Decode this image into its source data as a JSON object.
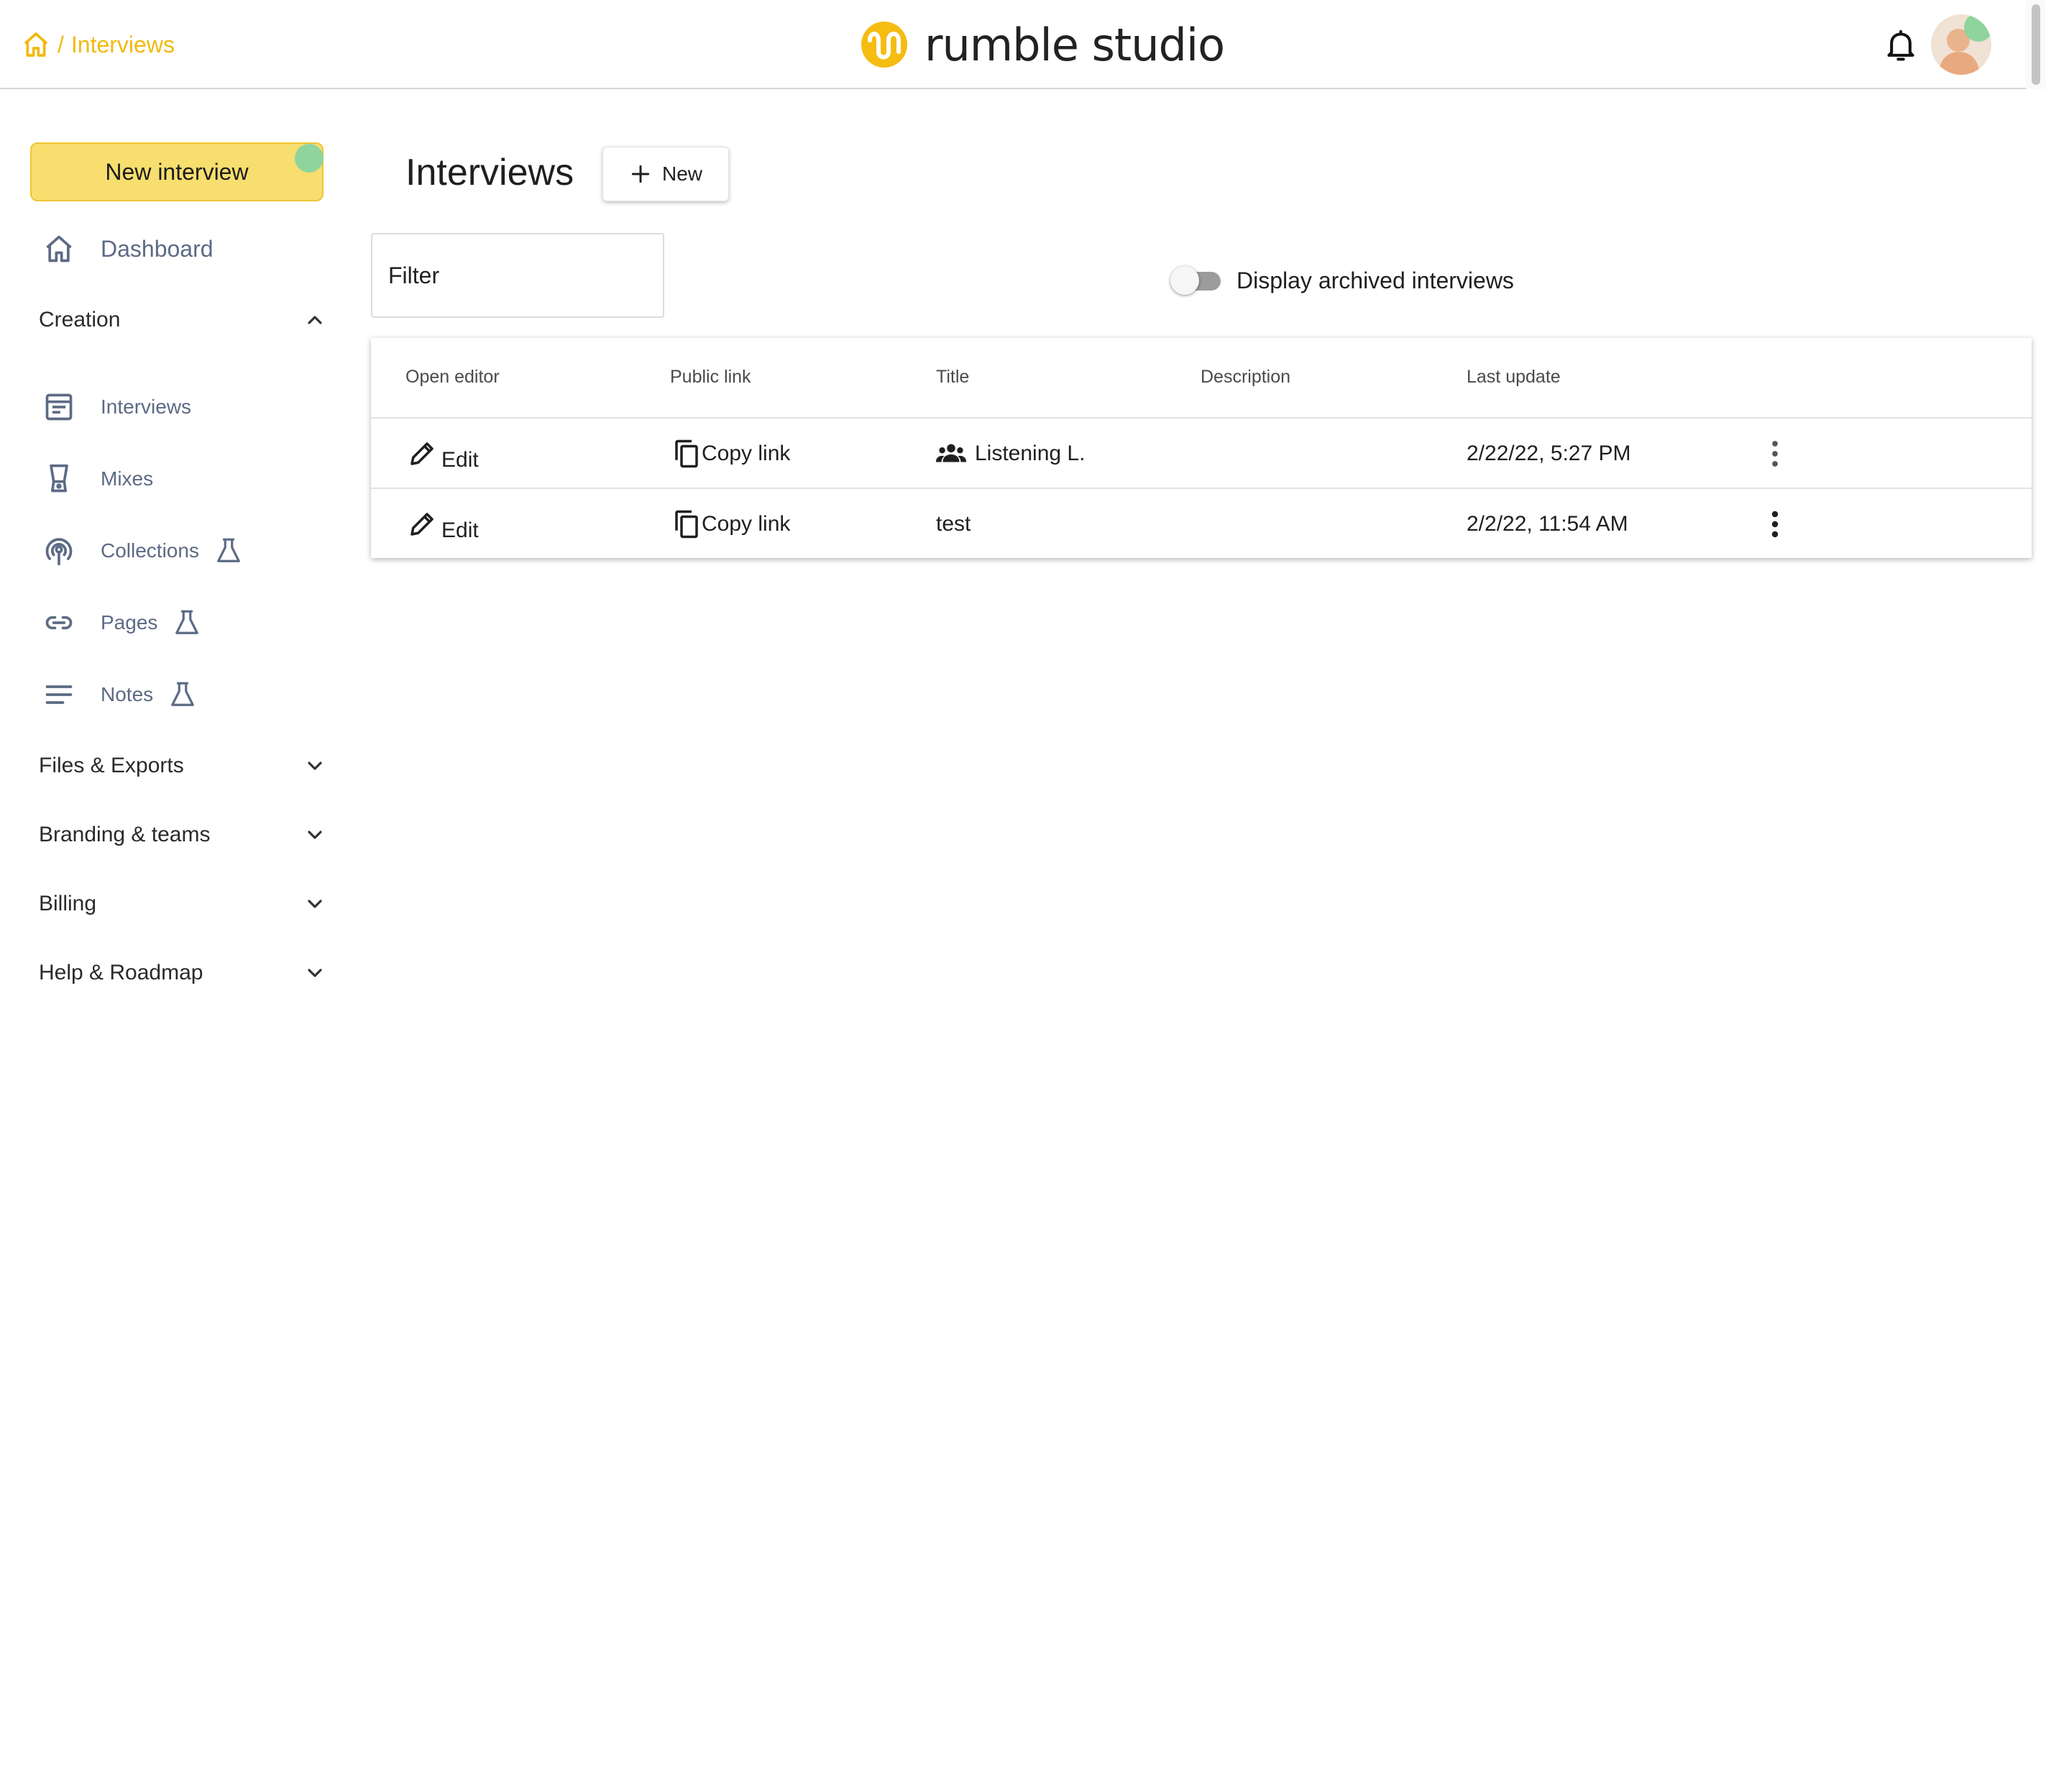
{
  "header": {
    "breadcrumb_separator": "/",
    "breadcrumb_current": "Interviews",
    "logo_text": "rumble studio",
    "accent_color": "#f2b90f"
  },
  "sidebar": {
    "new_interview_label": "New interview",
    "dashboard_label": "Dashboard",
    "creation_label": "Creation",
    "items": [
      {
        "label": "Interviews",
        "icon": "article-icon"
      },
      {
        "label": "Mixes",
        "icon": "blender-icon"
      },
      {
        "label": "Collections",
        "icon": "podcast-icon",
        "beta": true
      },
      {
        "label": "Pages",
        "icon": "link-icon",
        "beta": true
      },
      {
        "label": "Notes",
        "icon": "notes-icon",
        "beta": true
      }
    ],
    "sections": [
      {
        "label": "Files & Exports"
      },
      {
        "label": "Branding & teams"
      },
      {
        "label": "Billing"
      },
      {
        "label": "Help & Roadmap"
      }
    ]
  },
  "main": {
    "title": "Interviews",
    "new_button_label": "New",
    "filter_placeholder": "Filter",
    "archived_toggle_label": "Display archived interviews",
    "archived_toggle_on": false,
    "table": {
      "columns": [
        "Open editor",
        "Public link",
        "Title",
        "Description",
        "Last update"
      ],
      "rows": [
        {
          "edit": "Edit",
          "link": "Copy link",
          "title": "Listening L.",
          "shared": true,
          "description": "",
          "updated": "2/22/22, 5:27 PM"
        },
        {
          "edit": "Edit",
          "link": "Copy link",
          "title": "test",
          "shared": false,
          "description": "",
          "updated": "2/2/22, 11:54 AM"
        }
      ]
    }
  }
}
